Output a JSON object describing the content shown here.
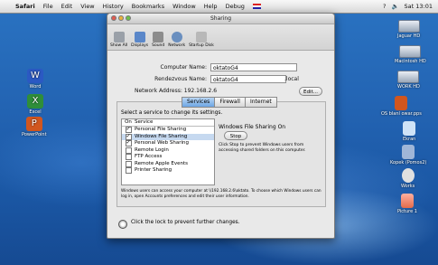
{
  "menubar": {
    "apple": "",
    "app": "Safari",
    "items": [
      "File",
      "Edit",
      "View",
      "History",
      "Bookmarks",
      "Window",
      "Help",
      "Debug"
    ],
    "status": "? ",
    "clock": "Sat 13:01"
  },
  "desktop_left": [
    {
      "label": "Word",
      "color": "#2b59c3"
    },
    {
      "label": "Excel",
      "color": "#2f8e3a"
    },
    {
      "label": "PowerPoint",
      "color": "#d1561f"
    }
  ],
  "desktop_right": [
    {
      "label": "Jaguar HD"
    },
    {
      "label": "Macintosh HD"
    },
    {
      "label": "WORK HD"
    },
    {
      "label": "OS blanl owar.pps"
    },
    {
      "label": "Ekran"
    },
    {
      "label": "Kopek (Pomos2)"
    },
    {
      "label": "Works"
    },
    {
      "label": "Picture 1"
    }
  ],
  "window": {
    "title": "Sharing",
    "toolbar": [
      "Show All",
      "Displays",
      "Sound",
      "Network",
      "Startup Disk"
    ],
    "computer_name_label": "Computer Name:",
    "computer_name": "oktatoG4",
    "rendezvous_label": "Rendezvous Name:",
    "rendezvous": "oktatoG4",
    "local": ".local",
    "address_label": "Network Address: 192.168.2.6",
    "edit": "Edit...",
    "tabs": [
      "Services",
      "Firewall",
      "Internet"
    ],
    "select_text": "Select a service to change its settings.",
    "col_on": "On",
    "col_service": "Service",
    "services": [
      {
        "name": "Personal File Sharing",
        "on": true
      },
      {
        "name": "Windows File Sharing",
        "on": true
      },
      {
        "name": "Personal Web Sharing",
        "on": true
      },
      {
        "name": "Remote Login",
        "on": false
      },
      {
        "name": "FTP Access",
        "on": false
      },
      {
        "name": "Remote Apple Events",
        "on": false
      },
      {
        "name": "Printer Sharing",
        "on": false
      }
    ],
    "status_title": "Windows File Sharing On",
    "stop": "Stop",
    "stop_desc": "Click Stop to prevent Windows users from accessing shared folders on this computer.",
    "footer_note": "Windows users can access your computer at \\\\192.168.2.6\\oktato. To choose which Windows users can log in, open Accounts preferences and edit their user information.",
    "lock_text": "Click the lock to prevent further changes."
  },
  "colors": {
    "accent": "#6da6e3",
    "desktop": "#2364b3"
  }
}
